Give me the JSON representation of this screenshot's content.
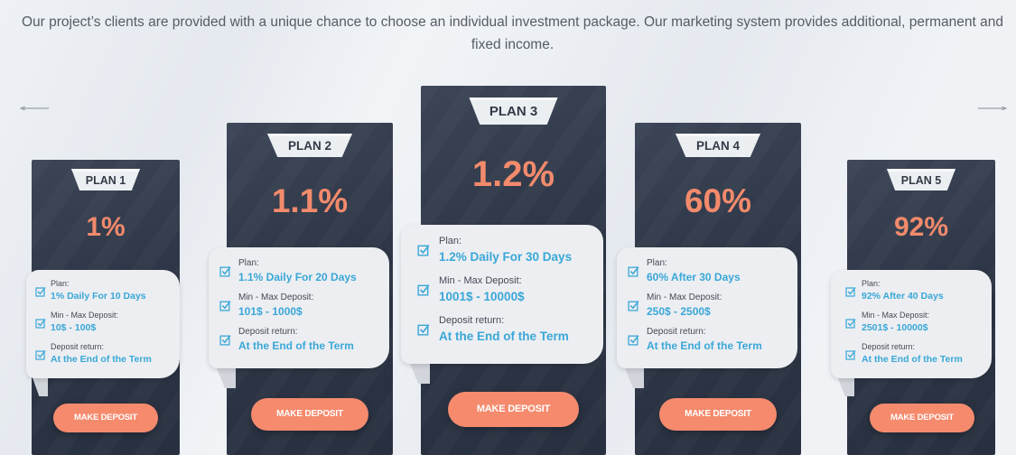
{
  "intro": {
    "text": "Our project’s clients are provided with a unique chance to choose an individual investment package. Our marketing system provides additional, permanent and fixed income."
  },
  "carousel": {
    "prev_icon": "arrow-left-icon",
    "next_icon": "arrow-right-icon"
  },
  "colors": {
    "card_bg": "#2e3747",
    "accent": "#f28a6c",
    "value_blue": "#3aa7d8",
    "info_bg": "#eceef1"
  },
  "plans": [
    {
      "name": "PLAN 1",
      "percent": "1%",
      "plan_label": "Plan:",
      "plan_value": "1% Daily For 10 Days",
      "deposit_label": "Min - Max Deposit:",
      "deposit_value": "10$ - 100$",
      "return_label": "Deposit return:",
      "return_value": "At the End of the Term",
      "button": "MAKE DEPOSIT"
    },
    {
      "name": "PLAN 2",
      "percent": "1.1%",
      "plan_label": "Plan:",
      "plan_value": "1.1% Daily For 20 Days",
      "deposit_label": "Min - Max Deposit:",
      "deposit_value": "101$ - 1000$",
      "return_label": "Deposit return:",
      "return_value": "At the End of the Term",
      "button": "MAKE DEPOSIT"
    },
    {
      "name": "PLAN 3",
      "percent": "1.2%",
      "plan_label": "Plan:",
      "plan_value": "1.2% Daily For 30 Days",
      "deposit_label": "Min - Max Deposit:",
      "deposit_value": "1001$ - 10000$",
      "return_label": "Deposit return:",
      "return_value": "At the End of the Term",
      "button": "MAKE DEPOSIT"
    },
    {
      "name": "PLAN 4",
      "percent": "60%",
      "plan_label": "Plan:",
      "plan_value": "60% After 30 Days",
      "deposit_label": "Min - Max Deposit:",
      "deposit_value": "250$ - 2500$",
      "return_label": "Deposit return:",
      "return_value": "At the End of the Term",
      "button": "MAKE DEPOSIT"
    },
    {
      "name": "PLAN 5",
      "percent": "92%",
      "plan_label": "Plan:",
      "plan_value": "92% After 40 Days",
      "deposit_label": "Min - Max Deposit:",
      "deposit_value": "2501$ - 10000$",
      "return_label": "Deposit return:",
      "return_value": "At the End of the Term",
      "button": "MAKE DEPOSIT"
    }
  ]
}
